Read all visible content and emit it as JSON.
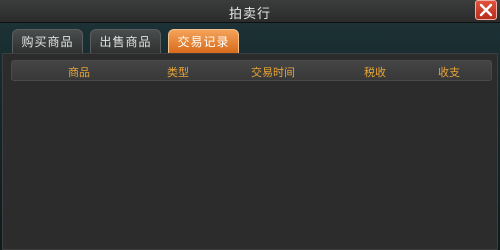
{
  "window": {
    "title": "拍卖行",
    "close_icon": "close-x-icon"
  },
  "tabs": [
    {
      "label": "购买商品",
      "active": false
    },
    {
      "label": "出售商品",
      "active": false
    },
    {
      "label": "交易记录",
      "active": true
    }
  ],
  "table": {
    "columns": [
      "商品",
      "类型",
      "交易时间",
      "税收",
      "收支"
    ],
    "rows": []
  },
  "colors": {
    "accent_tab": "#e07a2a",
    "header_text": "#e8a437",
    "close_button": "#c93a26"
  }
}
